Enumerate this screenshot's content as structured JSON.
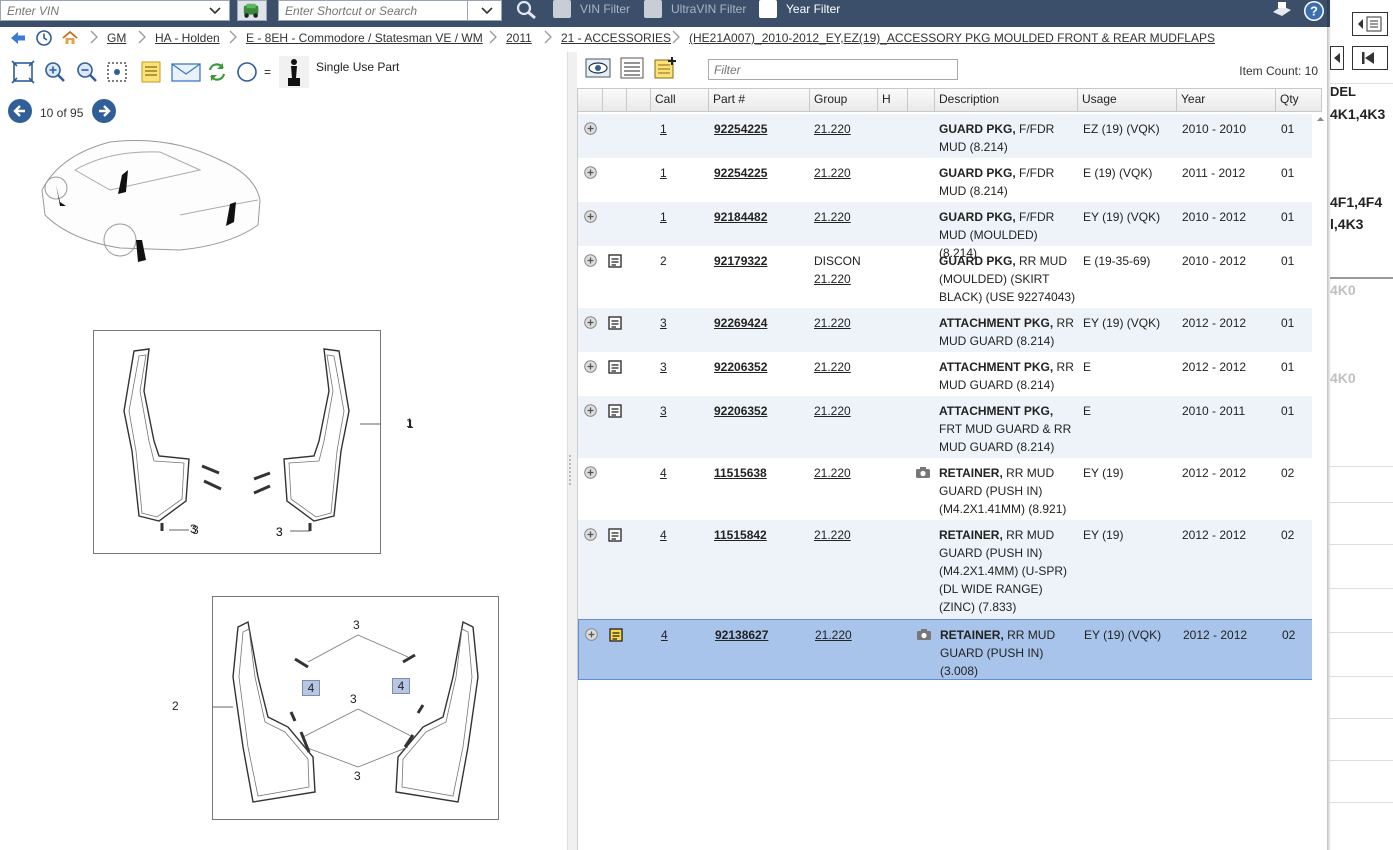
{
  "topbar": {
    "vin_placeholder": "Enter VIN",
    "shortcut_placeholder": "Enter Shortcut or Search",
    "vin_filter_label": "VIN Filter",
    "ultravin_filter_label": "UltraVIN Filter",
    "year_filter_label": "Year Filter"
  },
  "breadcrumb": [
    "GM",
    "HA - Holden",
    "E - 8EH - Commodore / Statesman VE / WM",
    "2011",
    "21 - ACCESSORIES",
    "(HE21A007)_2010-2012_EY,EZ(19)_ACCESSORY PKG MOULDED FRONT & REAR MUDFLAPS"
  ],
  "left_toolbar": {
    "single_use_label": "Single Use Part",
    "equals": "="
  },
  "pager": {
    "text": "10 of 95"
  },
  "illustration": {
    "callouts": [
      "1",
      "3",
      "3",
      "2",
      "3",
      "3",
      "3",
      "4",
      "4"
    ]
  },
  "right_toolbar": {
    "filter_placeholder": "Filter",
    "item_count": "Item Count: 10"
  },
  "grid": {
    "headers": [
      "Call",
      "Part #",
      "Group",
      "H",
      "Description",
      "Usage",
      "Year",
      "Qty"
    ],
    "rows": [
      {
        "call": "1",
        "call_link": true,
        "part": "92254225",
        "group1": "",
        "group": "21.220",
        "desc_bold": "GUARD PKG,",
        "desc": " F/FDR MUD (8.214)",
        "usage": "EZ (19) (VQK)",
        "year": "2010 - 2010",
        "qty": "01",
        "note": false,
        "cam": false
      },
      {
        "call": "1",
        "call_link": true,
        "part": "92254225",
        "group1": "",
        "group": "21.220",
        "desc_bold": "GUARD PKG,",
        "desc": " F/FDR MUD (8.214)",
        "usage": "E (19) (VQK)",
        "year": "2011 - 2012",
        "qty": "01",
        "note": false,
        "cam": false
      },
      {
        "call": "1",
        "call_link": true,
        "part": "92184482",
        "group1": "",
        "group": "21.220",
        "desc_bold": "GUARD PKG,",
        "desc": " F/FDR MUD (MOULDED) (8.214)",
        "usage": "EY (19) (VQK)",
        "year": "2010 - 2012",
        "qty": "01",
        "note": false,
        "cam": false
      },
      {
        "call": "2",
        "call_link": false,
        "part": "92179322",
        "group1": "DISCON",
        "group": "21.220",
        "desc_bold": "GUARD PKG,",
        "desc": " RR MUD (MOULDED) (SKIRT BLACK) (USE 92274043)",
        "usage": "E (19-35-69)",
        "year": "2010 - 2012",
        "qty": "01",
        "note": true,
        "cam": false
      },
      {
        "call": "3",
        "call_link": true,
        "part": "92269424",
        "group1": "",
        "group": "21.220",
        "desc_bold": "ATTACHMENT PKG,",
        "desc": " RR MUD GUARD (8.214)",
        "usage": "EY (19) (VQK)",
        "year": "2012 - 2012",
        "qty": "01",
        "note": true,
        "cam": false
      },
      {
        "call": "3",
        "call_link": true,
        "part": "92206352",
        "group1": "",
        "group": "21.220",
        "desc_bold": "ATTACHMENT PKG,",
        "desc": " RR MUD GUARD (8.214)",
        "usage": "E",
        "year": "2012 - 2012",
        "qty": "01",
        "note": true,
        "cam": false
      },
      {
        "call": "3",
        "call_link": true,
        "part": "92206352",
        "group1": "",
        "group": "21.220",
        "desc_bold": "ATTACHMENT PKG,",
        "desc": " FRT MUD GUARD & RR MUD GUARD (8.214)",
        "usage": "E",
        "year": "2010 - 2011",
        "qty": "01",
        "note": true,
        "cam": false
      },
      {
        "call": "4",
        "call_link": true,
        "part": "11515638",
        "group1": "",
        "group": "21.220",
        "desc_bold": "RETAINER,",
        "desc": " RR MUD GUARD (PUSH IN) (M4.2X1.41MM) (8.921)",
        "usage": "EY (19)",
        "year": "2012 - 2012",
        "qty": "02",
        "note": false,
        "cam": true
      },
      {
        "call": "4",
        "call_link": true,
        "part": "11515842",
        "group1": "",
        "group": "21.220",
        "desc_bold": "RETAINER,",
        "desc": " RR MUD GUARD (PUSH IN) (M4.2X1.4MM) (U-SPR) (DL WIDE RANGE) (ZINC) (7.833)",
        "usage": "EY (19)",
        "year": "2012 - 2012",
        "qty": "02",
        "note": true,
        "cam": false
      },
      {
        "call": "4",
        "call_link": true,
        "part": "92138627",
        "group1": "",
        "group": "21.220",
        "desc_bold": "RETAINER,",
        "desc": " RR MUD GUARD (PUSH IN) (3.008)",
        "usage": "EY (19) (VQK)",
        "year": "2012 - 2012",
        "qty": "02",
        "note": true,
        "cam": true
      }
    ]
  },
  "background_right": {
    "col_header": "DEL",
    "texts": [
      "4K1,4K3",
      "4F1,4F4",
      "l,4K3",
      "4K0",
      "4K0"
    ]
  },
  "colors": {
    "topbar": "#3b4f6b",
    "selected_row": "#a9c4ea",
    "alt_row": "#eef3f9",
    "nav_button": "#2f5e98"
  }
}
